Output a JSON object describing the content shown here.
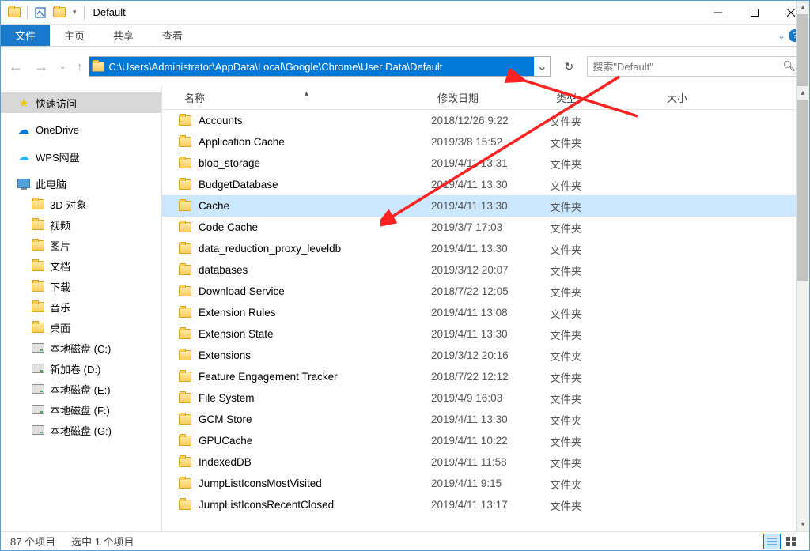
{
  "titlebar": {
    "title": "Default"
  },
  "ribbon": {
    "file": "文件",
    "tabs": [
      "主页",
      "共享",
      "查看"
    ]
  },
  "navbar": {
    "path": "C:\\Users\\Administrator\\AppData\\Local\\Google\\Chrome\\User Data\\Default",
    "search_placeholder": "搜索\"Default\""
  },
  "sidebar": {
    "quick_access": "快速访问",
    "onedrive": "OneDrive",
    "wps": "WPS网盘",
    "this_pc": "此电脑",
    "pc_items": [
      {
        "label": "3D 对象"
      },
      {
        "label": "视频"
      },
      {
        "label": "图片"
      },
      {
        "label": "文档"
      },
      {
        "label": "下载"
      },
      {
        "label": "音乐"
      },
      {
        "label": "桌面"
      },
      {
        "label": "本地磁盘 (C:)"
      },
      {
        "label": "新加卷 (D:)"
      },
      {
        "label": "本地磁盘 (E:)"
      },
      {
        "label": "本地磁盘 (F:)"
      },
      {
        "label": "本地磁盘 (G:)"
      }
    ]
  },
  "columns": {
    "name": "名称",
    "date": "修改日期",
    "type": "类型",
    "size": "大小"
  },
  "files": [
    {
      "name": "Accounts",
      "date": "2018/12/26 9:22",
      "type": "文件夹"
    },
    {
      "name": "Application Cache",
      "date": "2019/3/8 15:52",
      "type": "文件夹"
    },
    {
      "name": "blob_storage",
      "date": "2019/4/11 13:31",
      "type": "文件夹"
    },
    {
      "name": "BudgetDatabase",
      "date": "2019/4/11 13:30",
      "type": "文件夹"
    },
    {
      "name": "Cache",
      "date": "2019/4/11 13:30",
      "type": "文件夹",
      "selected": true
    },
    {
      "name": "Code Cache",
      "date": "2019/3/7 17:03",
      "type": "文件夹"
    },
    {
      "name": "data_reduction_proxy_leveldb",
      "date": "2019/4/11 13:30",
      "type": "文件夹"
    },
    {
      "name": "databases",
      "date": "2019/3/12 20:07",
      "type": "文件夹"
    },
    {
      "name": "Download Service",
      "date": "2018/7/22 12:05",
      "type": "文件夹"
    },
    {
      "name": "Extension Rules",
      "date": "2019/4/11 13:08",
      "type": "文件夹"
    },
    {
      "name": "Extension State",
      "date": "2019/4/11 13:30",
      "type": "文件夹"
    },
    {
      "name": "Extensions",
      "date": "2019/3/12 20:16",
      "type": "文件夹"
    },
    {
      "name": "Feature Engagement Tracker",
      "date": "2018/7/22 12:12",
      "type": "文件夹"
    },
    {
      "name": "File System",
      "date": "2019/4/9 16:03",
      "type": "文件夹"
    },
    {
      "name": "GCM Store",
      "date": "2019/4/11 13:30",
      "type": "文件夹"
    },
    {
      "name": "GPUCache",
      "date": "2019/4/11 10:22",
      "type": "文件夹"
    },
    {
      "name": "IndexedDB",
      "date": "2019/4/11 11:58",
      "type": "文件夹"
    },
    {
      "name": "JumpListIconsMostVisited",
      "date": "2019/4/11 9:15",
      "type": "文件夹"
    },
    {
      "name": "JumpListIconsRecentClosed",
      "date": "2019/4/11 13:17",
      "type": "文件夹"
    }
  ],
  "statusbar": {
    "count": "87 个项目",
    "selected": "选中 1 个项目"
  }
}
